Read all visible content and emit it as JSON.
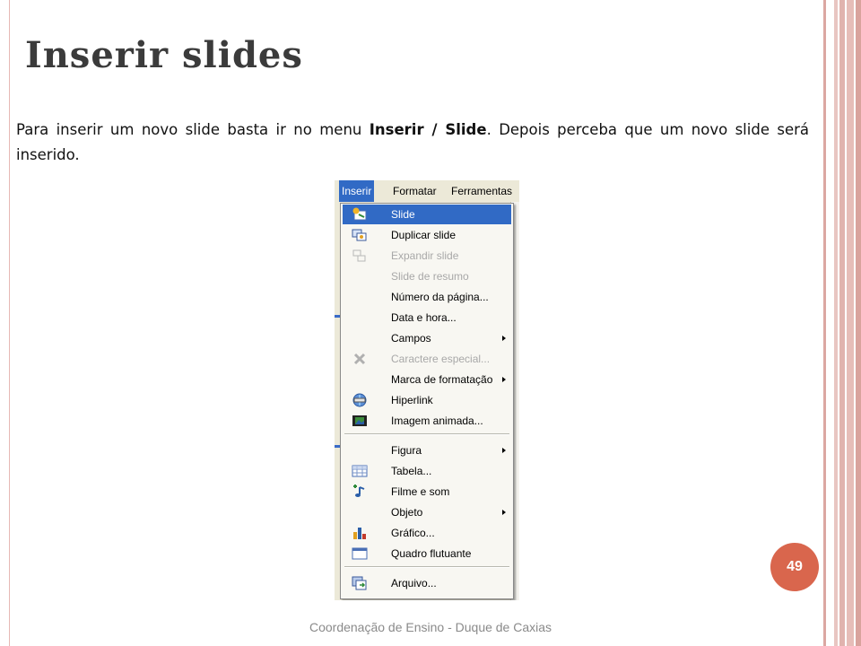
{
  "slide": {
    "title": "Inserir slides",
    "body": {
      "part1": "Para inserir um novo slide basta ir no menu ",
      "bold": "Inserir / Slide",
      "part2": ". Depois perceba que um novo slide será inserido."
    },
    "page_number": "49",
    "footer": "Coordenação de Ensino - Duque de Caxias"
  },
  "screenshot": {
    "menubar": [
      {
        "label": "Inserir",
        "active": true
      },
      {
        "label": "Formatar",
        "active": false
      },
      {
        "label": "Ferramentas",
        "active": false
      }
    ],
    "menu_items": [
      {
        "label": "Slide",
        "icon": "new-slide-icon",
        "highlighted": true,
        "disabled": false,
        "submenu": false
      },
      {
        "label": "Duplicar slide",
        "icon": "duplicate-slide-icon",
        "highlighted": false,
        "disabled": false,
        "submenu": false
      },
      {
        "label": "Expandir slide",
        "icon": "expand-slide-icon",
        "highlighted": false,
        "disabled": true,
        "submenu": false
      },
      {
        "label": "Slide de resumo",
        "icon": "",
        "highlighted": false,
        "disabled": true,
        "submenu": false
      },
      {
        "label": "Número da página...",
        "icon": "",
        "highlighted": false,
        "disabled": false,
        "submenu": false
      },
      {
        "label": "Data e hora...",
        "icon": "",
        "highlighted": false,
        "disabled": false,
        "submenu": false
      },
      {
        "label": "Campos",
        "icon": "",
        "highlighted": false,
        "disabled": false,
        "submenu": true
      },
      {
        "label": "Caractere especial...",
        "icon": "special-character-icon",
        "highlighted": false,
        "disabled": true,
        "submenu": false
      },
      {
        "label": "Marca de formatação",
        "icon": "",
        "highlighted": false,
        "disabled": false,
        "submenu": true
      },
      {
        "label": "Hiperlink",
        "icon": "hyperlink-icon",
        "highlighted": false,
        "disabled": false,
        "submenu": false
      },
      {
        "label": "Imagem animada...",
        "icon": "animated-image-icon",
        "highlighted": false,
        "disabled": false,
        "submenu": false
      },
      {
        "label": "Figura",
        "icon": "",
        "highlighted": false,
        "disabled": false,
        "submenu": true
      },
      {
        "label": "Tabela...",
        "icon": "table-icon",
        "highlighted": false,
        "disabled": false,
        "submenu": false
      },
      {
        "label": "Filme e som",
        "icon": "movie-sound-icon",
        "highlighted": false,
        "disabled": false,
        "submenu": false
      },
      {
        "label": "Objeto",
        "icon": "",
        "highlighted": false,
        "disabled": false,
        "submenu": true
      },
      {
        "label": "Gráfico...",
        "icon": "chart-icon",
        "highlighted": false,
        "disabled": false,
        "submenu": false
      },
      {
        "label": "Quadro flutuante",
        "icon": "floating-frame-icon",
        "highlighted": false,
        "disabled": false,
        "submenu": false
      },
      {
        "label": "Arquivo...",
        "icon": "file-insert-icon",
        "highlighted": false,
        "disabled": false,
        "submenu": false
      }
    ]
  },
  "colors": {
    "highlight": "#316ac5",
    "badge": "#d9664d",
    "frame": "#dba7a2"
  }
}
